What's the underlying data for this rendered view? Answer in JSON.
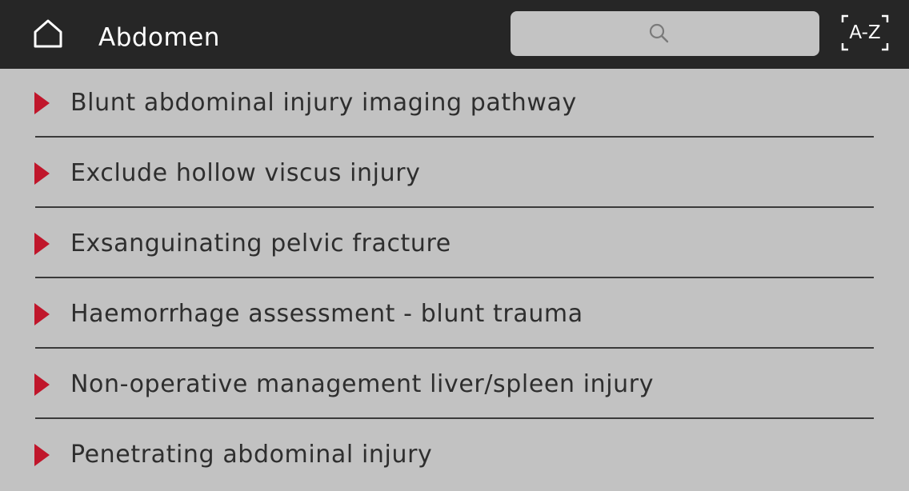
{
  "header": {
    "home_icon": "home-icon",
    "title": "Abdomen",
    "search": {
      "icon": "search-icon",
      "placeholder": "",
      "value": ""
    },
    "az_button": {
      "icon": "az-sort-icon",
      "label": "A-Z"
    },
    "background_color": "#262626"
  },
  "list": {
    "chevron_icon": "chevron-right-icon",
    "chevron_color": "#c0162b",
    "background_color": "#c2c2c2",
    "items": [
      {
        "label": "Blunt abdominal injury imaging pathway"
      },
      {
        "label": "Exclude hollow viscus injury"
      },
      {
        "label": "Exsanguinating pelvic fracture"
      },
      {
        "label": "Haemorrhage assessment - blunt trauma"
      },
      {
        "label": "Non-operative management liver/spleen injury"
      },
      {
        "label": "Penetrating abdominal injury"
      }
    ]
  }
}
